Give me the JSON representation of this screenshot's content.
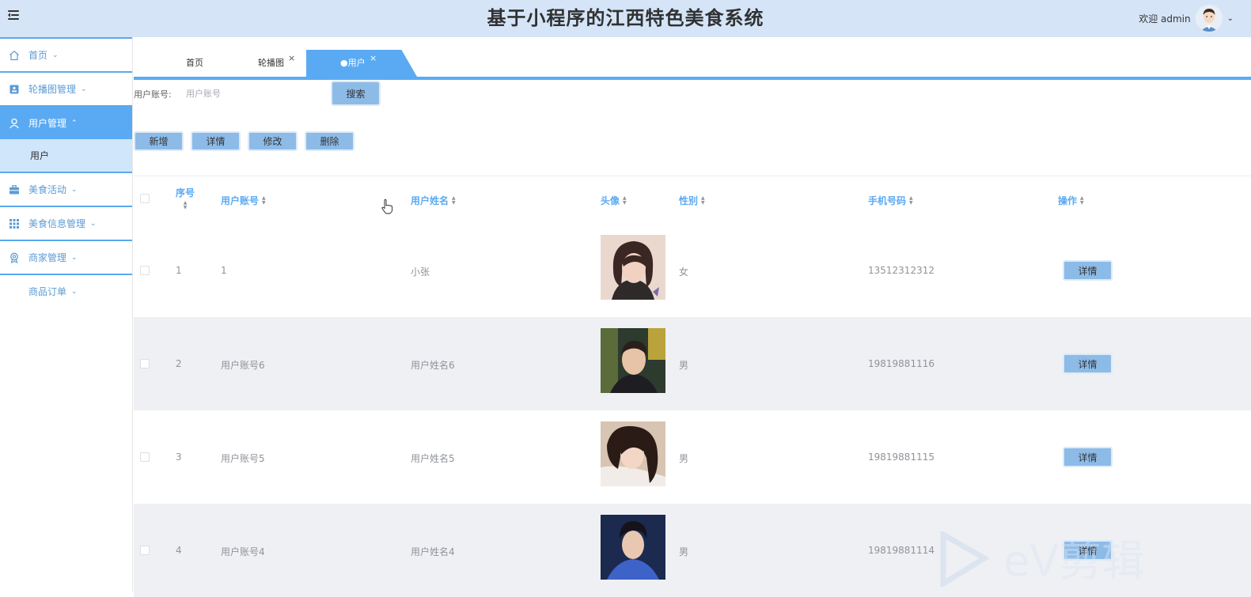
{
  "header": {
    "title": "基于小程序的江西特色美食系统",
    "welcome": "欢迎 admin",
    "menu_icon": "menu-fold-icon",
    "caret": "⌄"
  },
  "sidebar": {
    "items": [
      {
        "label": "首页",
        "icon": "home-icon"
      },
      {
        "label": "轮播图管理",
        "icon": "picture-icon"
      },
      {
        "label": "用户管理",
        "icon": "user-icon",
        "active": true,
        "sub": [
          "用户"
        ]
      },
      {
        "label": "美食活动",
        "icon": "briefcase-icon"
      },
      {
        "label": "美食信息管理",
        "icon": "grid-icon"
      },
      {
        "label": "商家管理",
        "icon": "award-icon"
      },
      {
        "label": "商品订单",
        "icon": "none"
      }
    ],
    "chev_down": "⌄",
    "chev_up": "⌃"
  },
  "tabs": [
    {
      "label": "首页"
    },
    {
      "label": "轮播图",
      "close": "×"
    },
    {
      "label": "●用户",
      "close": "×",
      "active": true
    }
  ],
  "search": {
    "label": "用户账号:",
    "placeholder": "用户账号",
    "button": "搜索"
  },
  "actions": {
    "add": "新增",
    "detail": "详情",
    "edit": "修改",
    "delete": "删除"
  },
  "table": {
    "columns": [
      "序号",
      "用户账号",
      "用户姓名",
      "头像",
      "性别",
      "手机号码",
      "操作"
    ],
    "rows": [
      {
        "index": "1",
        "account": "1",
        "name": "小张",
        "gender": "女",
        "phone": "13512312312",
        "action": "详情"
      },
      {
        "index": "2",
        "account": "用户账号6",
        "name": "用户姓名6",
        "gender": "男",
        "phone": "19819881116",
        "action": "详情"
      },
      {
        "index": "3",
        "account": "用户账号5",
        "name": "用户姓名5",
        "gender": "男",
        "phone": "19819881115",
        "action": "详情"
      },
      {
        "index": "4",
        "account": "用户账号4",
        "name": "用户姓名4",
        "gender": "男",
        "phone": "19819881114",
        "action": "详情"
      }
    ]
  },
  "watermark": "eV剪辑",
  "colors": {
    "accent": "#5aaaf3",
    "header_bg": "#d5e5f7",
    "button": "#8dbbe8"
  }
}
